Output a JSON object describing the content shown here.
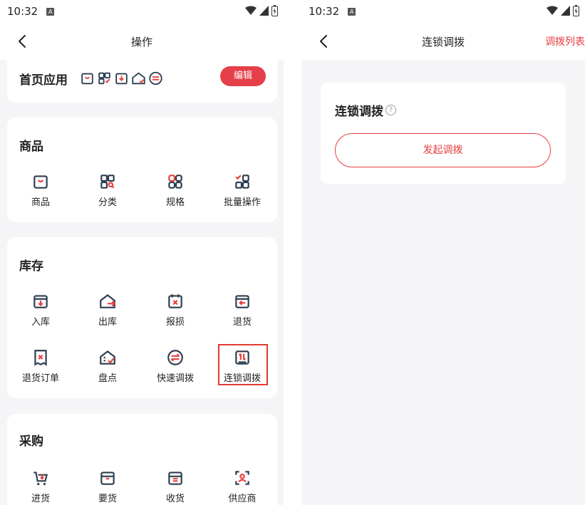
{
  "status_bar": {
    "time": "10:32",
    "sim_badge": "A"
  },
  "left_screen": {
    "nav": {
      "title": "操作"
    },
    "home_apps": {
      "title": "首页应用",
      "edit_label": "编辑",
      "shortcut_icons": [
        "product-icon",
        "spec-icon",
        "stock-in-icon",
        "inventory-check-icon",
        "quick-transfer-icon"
      ]
    },
    "sections": [
      {
        "title": "商品",
        "items": [
          {
            "label": "商品",
            "icon": "bag-icon"
          },
          {
            "label": "分类",
            "icon": "category-grid-icon"
          },
          {
            "label": "规格",
            "icon": "spec-grid-icon"
          },
          {
            "label": "批量操作",
            "icon": "batch-check-icon"
          }
        ]
      },
      {
        "title": "库存",
        "items": [
          {
            "label": "入库",
            "icon": "box-in-icon"
          },
          {
            "label": "出库",
            "icon": "house-out-icon"
          },
          {
            "label": "报损",
            "icon": "calendar-x-icon"
          },
          {
            "label": "退货",
            "icon": "box-return-icon"
          },
          {
            "label": "退货订单",
            "icon": "receipt-icon"
          },
          {
            "label": "盘点",
            "icon": "house-check-icon"
          },
          {
            "label": "快速调拨",
            "icon": "swap-circle-icon"
          },
          {
            "label": "连锁调拨",
            "icon": "chain-transfer-icon"
          }
        ]
      },
      {
        "title": "采购",
        "items": [
          {
            "label": "进货",
            "icon": "cart-icon"
          },
          {
            "label": "要货",
            "icon": "box-request-icon"
          },
          {
            "label": "收货",
            "icon": "box-receive-icon"
          },
          {
            "label": "供应商",
            "icon": "supplier-icon"
          }
        ]
      }
    ]
  },
  "right_screen": {
    "nav": {
      "title": "连锁调拨",
      "action": "调拨列表"
    },
    "card": {
      "title": "连锁调拨",
      "help_mark": "?",
      "button": "发起调拨"
    }
  },
  "colors": {
    "accent": "#e5403f",
    "icon_dark": "#2d3e50",
    "highlight": "#e03a33",
    "background": "#f5f5f7"
  }
}
